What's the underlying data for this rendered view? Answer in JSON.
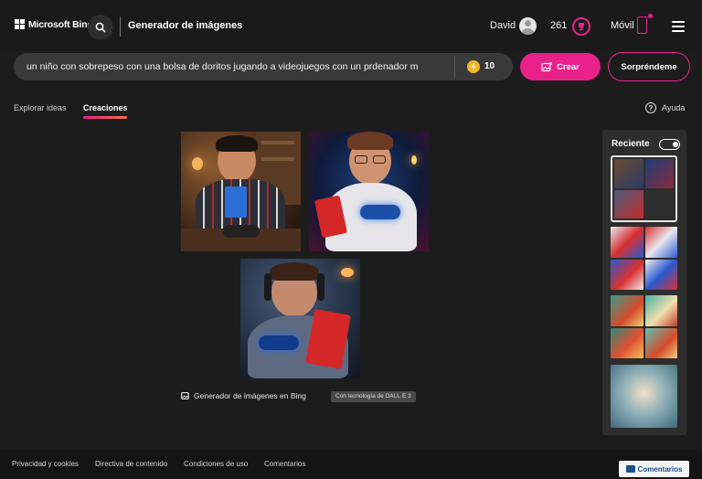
{
  "header": {
    "brand": "Microsoft Bing",
    "app_title": "Generador de imágenes",
    "user_name": "David",
    "points": "261",
    "mobile_label": "Móvil",
    "icons": [
      "microsoft-logo-icon",
      "search-icon",
      "avatar-icon",
      "trophy-icon",
      "phone-icon",
      "hamburger-menu-icon"
    ]
  },
  "prompt": {
    "value": "un niño con sobrepeso con una bolsa de doritos jugando a videojuegos con un prdenador m",
    "boosts": "10",
    "create_label": "Crear",
    "surprise_label": "Sorpréndeme"
  },
  "tabs": [
    {
      "label": "Explorar ideas",
      "active": false
    },
    {
      "label": "Creaciones",
      "active": true
    }
  ],
  "help_label": "Ayuda",
  "results": {
    "images": [
      {
        "subject": "boy with doritos bag and controller at desk"
      },
      {
        "subject": "boy with glasses holding doritos and blue controller"
      },
      {
        "subject": "boy with headphones, doritos bag and controller"
      }
    ],
    "caption": "Generador de imágenes en Bing",
    "badge": "Con tecnología de DALL·E 3"
  },
  "recent": {
    "title": "Reciente",
    "toggle_on": true
  },
  "footer": {
    "links": [
      "Privacidad y cookies",
      "Directiva de contenido",
      "Condiciones de uso",
      "Comentarios"
    ],
    "feedback_label": "Comentarios"
  },
  "colors": {
    "accent": "#e8218a",
    "background": "#1d1c1c",
    "prompt_bg": "#3a3939",
    "panel_bg": "#2e2d2d"
  }
}
